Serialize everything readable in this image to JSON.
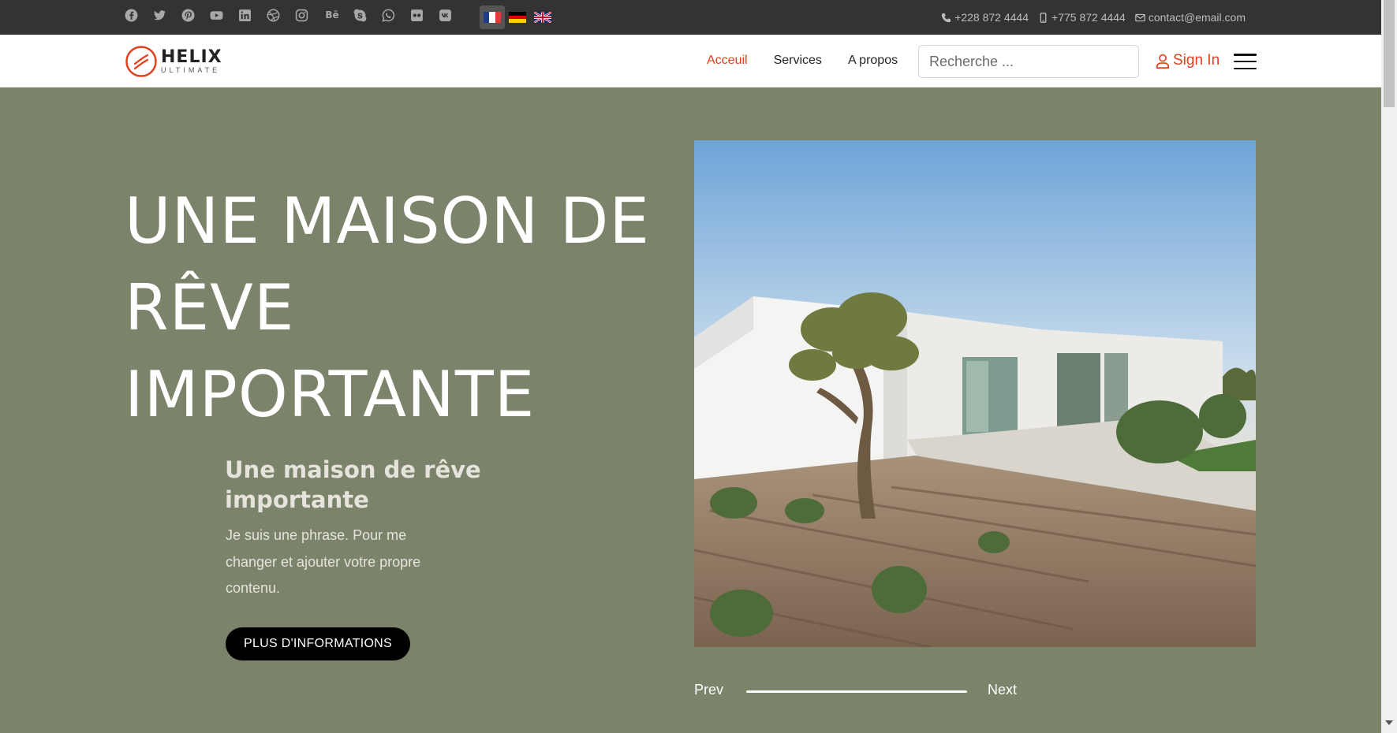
{
  "topbar": {
    "social_icons": [
      "facebook-icon",
      "twitter-icon",
      "pinterest-icon",
      "youtube-icon",
      "linkedin-icon",
      "dribbble-icon",
      "instagram-icon",
      "behance-icon",
      "skype-icon",
      "whatsapp-icon",
      "flickr-icon",
      "vk-icon"
    ],
    "behance_label": "Bē",
    "languages": [
      {
        "code": "fr",
        "active": true
      },
      {
        "code": "de",
        "active": false
      },
      {
        "code": "en",
        "active": false
      }
    ],
    "phone": "+228 872 4444",
    "mobile": "+775 872 4444",
    "email": "contact@email.com"
  },
  "header": {
    "logo_name": "HELIX",
    "logo_sub": "ULTIMATE",
    "nav": [
      {
        "label": "Acceuil",
        "active": true
      },
      {
        "label": "Services",
        "active": false
      },
      {
        "label": "A propos",
        "active": false
      }
    ],
    "search_placeholder": "Recherche ...",
    "signin_label": "Sign In"
  },
  "hero": {
    "title": "UNE MAISON DE RÊVE IMPORTANTE",
    "subtitle": "Une maison de rêve importante",
    "description": "Je suis une phrase. Pour me changer et ajouter votre propre contenu.",
    "cta_label": "PLUS D'INFORMATIONS",
    "prev_label": "Prev",
    "next_label": "Next"
  },
  "colors": {
    "accent": "#e1401f",
    "hero_bg": "#7b846a",
    "topbar_bg": "#333333"
  }
}
